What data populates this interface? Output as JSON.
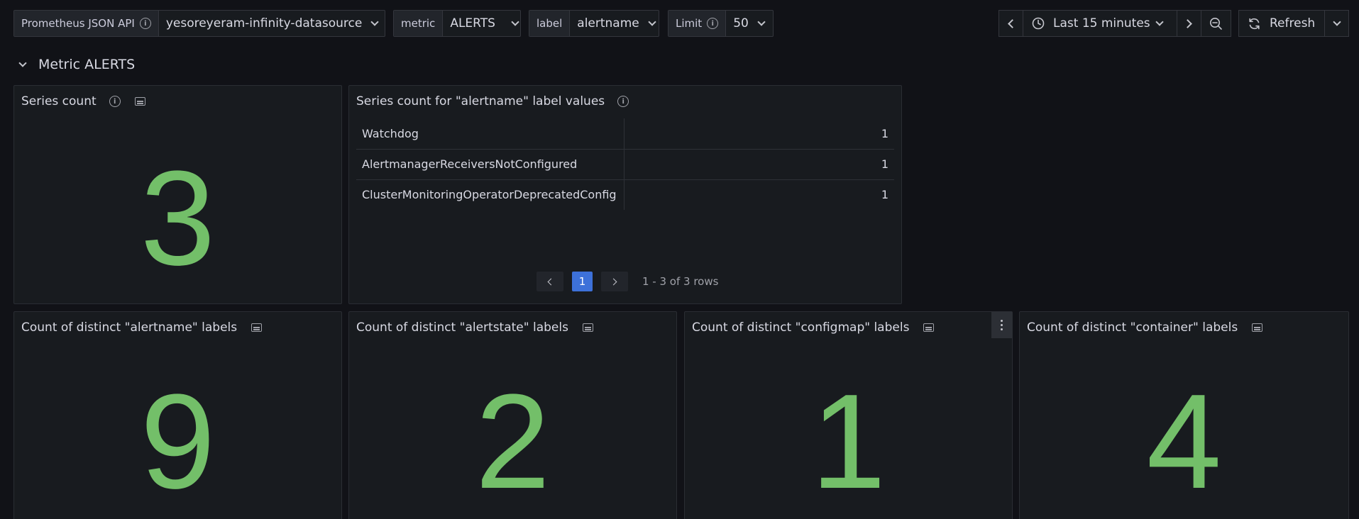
{
  "variables": [
    {
      "label": "Prometheus JSON API",
      "has_info": true,
      "value": "yesoreyeram-infinity-datasource"
    },
    {
      "label": "metric",
      "has_info": false,
      "value": "ALERTS"
    },
    {
      "label": "label",
      "has_info": false,
      "value": "alertname"
    },
    {
      "label": "Limit",
      "has_info": true,
      "value": "50"
    }
  ],
  "time_picker": {
    "range": "Last 15 minutes"
  },
  "refresh": {
    "label": "Refresh"
  },
  "row": {
    "title": "Metric ALERTS"
  },
  "panels": {
    "series_count": {
      "title": "Series count",
      "value": "3"
    },
    "label_values": {
      "title": "Series count for \"alertname\" label values",
      "rows": [
        {
          "name": "Watchdog",
          "count": "1"
        },
        {
          "name": "AlertmanagerReceiversNotConfigured",
          "count": "1"
        },
        {
          "name": "ClusterMonitoringOperatorDeprecatedConfig",
          "count": "1"
        }
      ],
      "page": "1",
      "pagination_text": "1 - 3 of 3 rows"
    },
    "alertname": {
      "title": "Count of distinct \"alertname\" labels",
      "value": "9"
    },
    "alertstate": {
      "title": "Count of distinct \"alertstate\" labels",
      "value": "2"
    },
    "configmap": {
      "title": "Count of distinct \"configmap\" labels",
      "value": "1"
    },
    "container": {
      "title": "Count of distinct \"container\" labels",
      "value": "4"
    }
  },
  "colors": {
    "stat_green": "#73bf69",
    "background": "#111217",
    "panel": "#181b1f",
    "accent_blue": "#3d71d9"
  }
}
